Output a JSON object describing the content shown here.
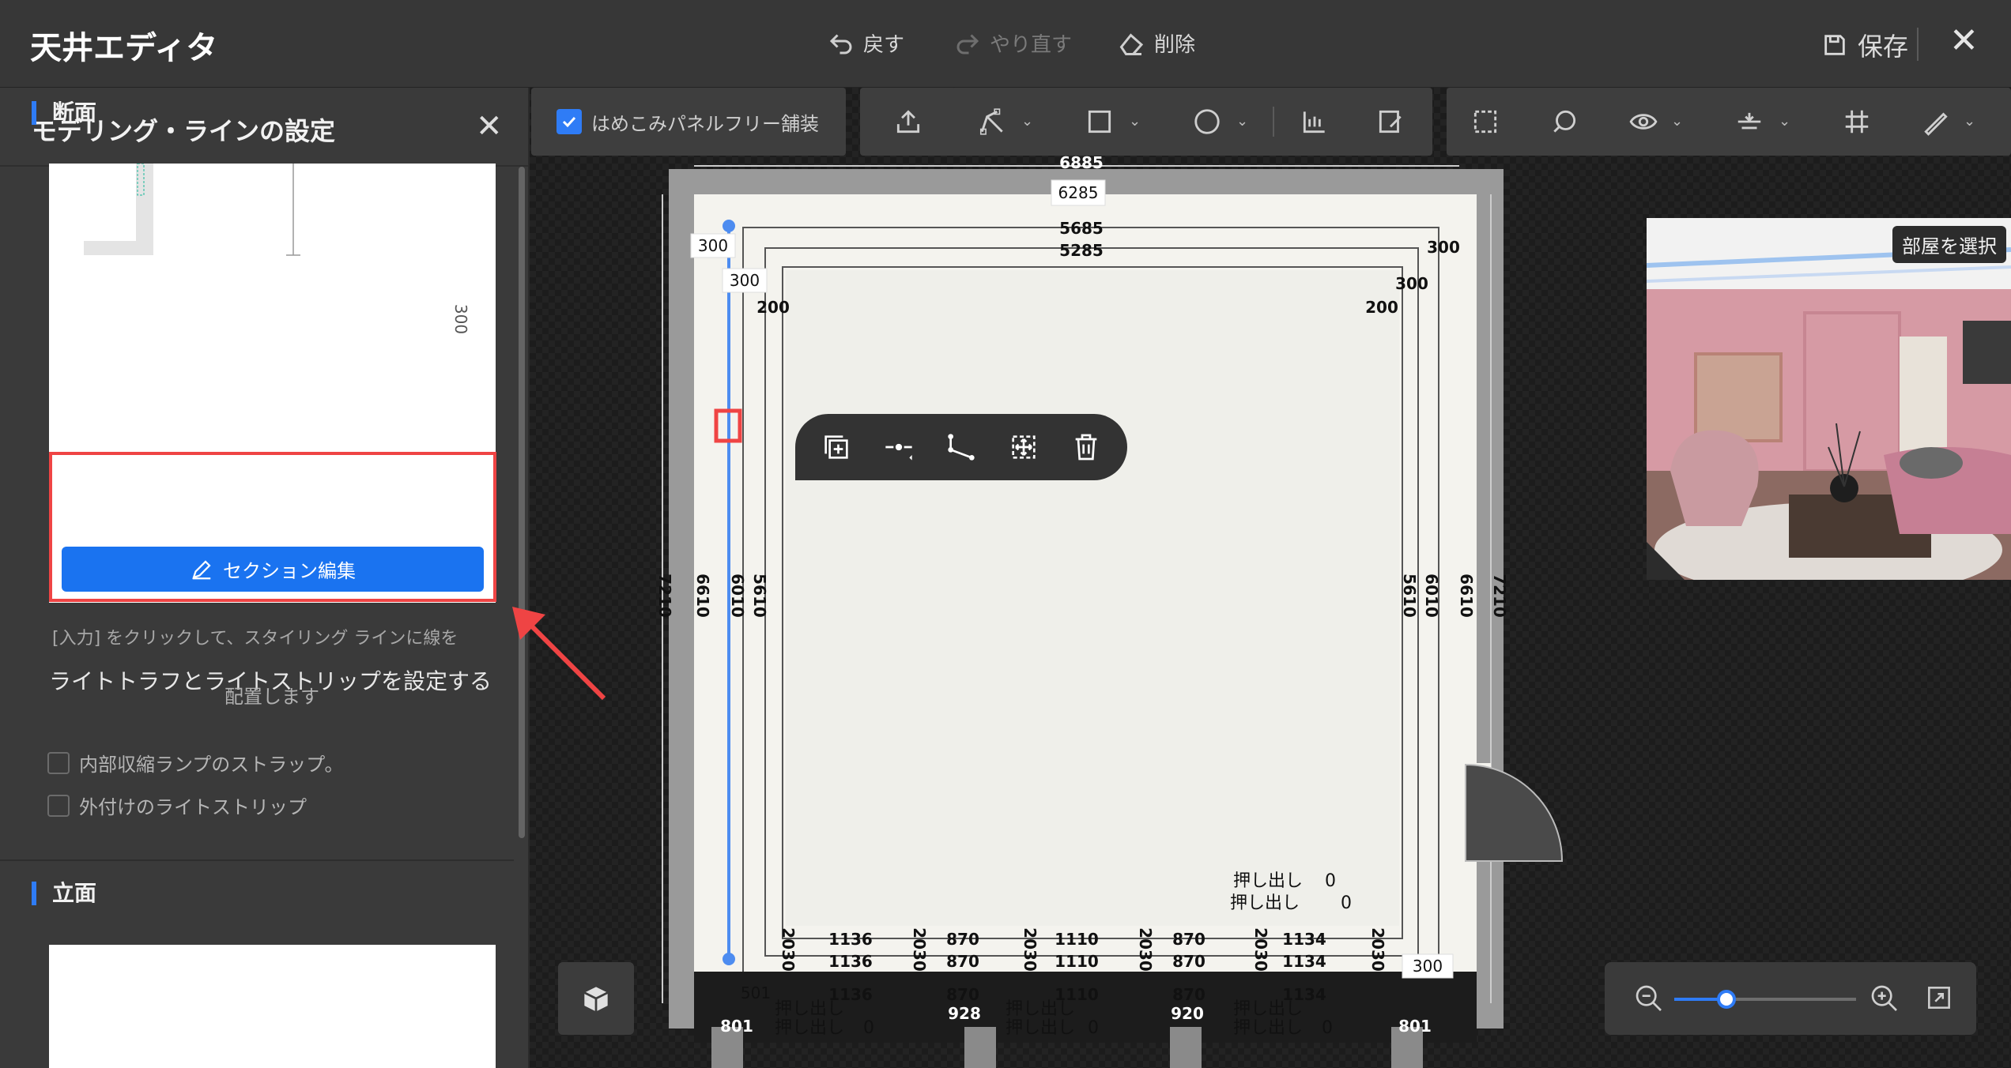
{
  "title_bar": {
    "app_title": "天井エディタ",
    "undo_label": "戻す",
    "redo_label": "やり直す",
    "delete_label": "削除",
    "save_label": "保存"
  },
  "left_panel": {
    "title": "モデリング・ラインの設定",
    "section_danmen": "断面",
    "preview_dim": "300",
    "edit_button": "セクション編集",
    "hint_line1": "[入力] をクリックして、スタイリング ラインに線を",
    "hint_line2": "配置します",
    "light_title": "ライトトラフとライトストリップを設定する",
    "checkbox1": "内部収縮ランプのストラップ。",
    "checkbox2": "外付けのライトストリップ",
    "section_ritsumen": "立面"
  },
  "toolbar": {
    "fill_label": "はめこみパネルフリー舗装",
    "fill_checked": true
  },
  "plan": {
    "dims_top": [
      "6885",
      "6285",
      "5685",
      "5285"
    ],
    "dims_side_left": [
      "7210",
      "6610",
      "6010",
      "5610"
    ],
    "dims_side_right": [
      "5610",
      "6010",
      "6610",
      "7210"
    ],
    "corner_300": "300",
    "corner_200": "200",
    "bottom_1136": "1136",
    "bottom_870": "870",
    "bottom_1110": "1110",
    "bottom_1134": "1134",
    "bottom_2030": "2030",
    "push_out": "押し出し",
    "zero": "0",
    "dim_501": "501",
    "dim_801": "801",
    "dim_300b": "300",
    "dim_920": "920",
    "dim_928": "928"
  },
  "room_preview": {
    "select_label": "部屋を選択"
  },
  "colors": {
    "accent": "#2f7cf6",
    "highlight": "#ef4444"
  }
}
